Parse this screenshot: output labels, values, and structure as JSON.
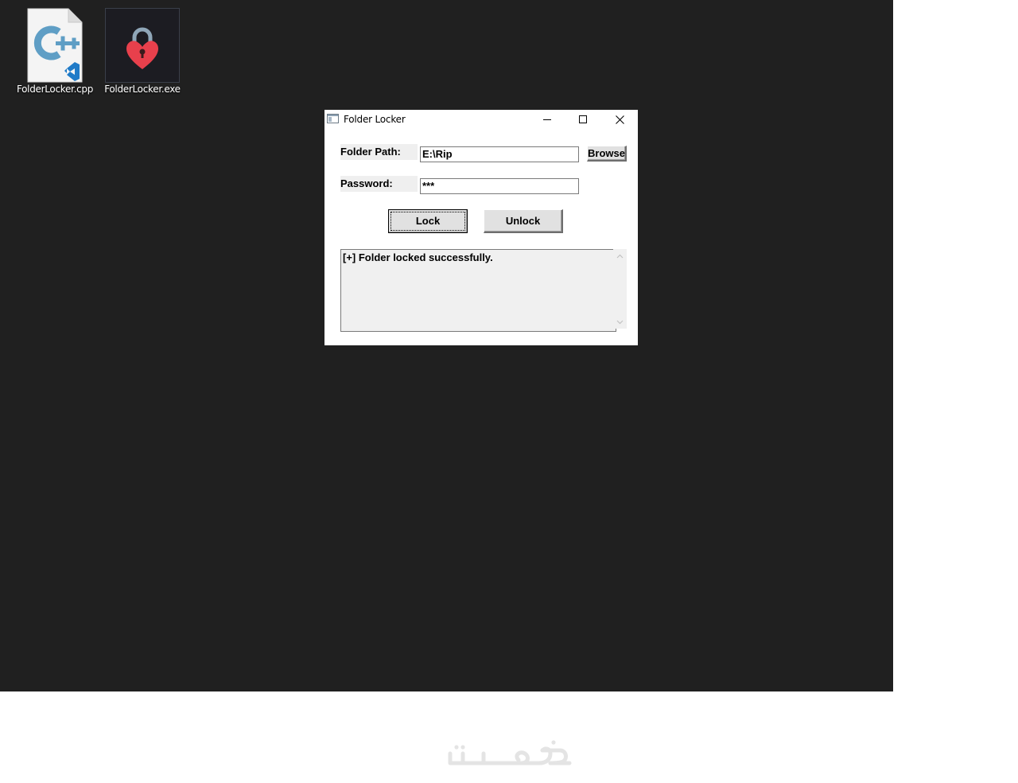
{
  "desktop": {
    "icons": [
      {
        "label": "FolderLocker.cpp",
        "icon": "cpp-file-icon"
      },
      {
        "label": "FolderLocker.exe",
        "icon": "heart-lock-icon"
      }
    ]
  },
  "window": {
    "title": "Folder Locker",
    "controls": [
      "minimize-icon",
      "maximize-icon",
      "close-icon"
    ],
    "folder_path_label": "Folder Path:",
    "folder_path_value": "E:\\Rip",
    "browse_label": "Browse",
    "password_label": "Password:",
    "password_value": "***",
    "lock_label": "Lock",
    "unlock_label": "Unlock",
    "output_text": "[+] Folder locked successfully."
  },
  "colors": {
    "desktop_bg": "#202020",
    "window_bg": "#ffffff",
    "label_bg": "#efefef",
    "lock_red": "#e8404c",
    "lock_shackle": "#8fa6b8",
    "cpp_blue": "#5f9ec5",
    "vscode_blue": "#1f7bc8"
  },
  "watermark": {
    "icon": "khamsat-logo"
  }
}
